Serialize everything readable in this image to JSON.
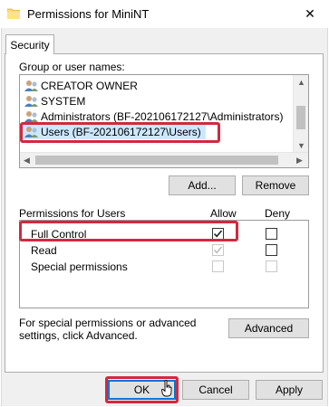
{
  "window": {
    "title": "Permissions for MiniNT",
    "close_glyph": "✕"
  },
  "tabs": [
    {
      "label": "Security",
      "active": true
    }
  ],
  "groups": {
    "label": "Group or user names:",
    "items": [
      {
        "name": "CREATOR OWNER",
        "icon": "users-icon",
        "selected": false
      },
      {
        "name": "SYSTEM",
        "icon": "users-icon",
        "selected": false
      },
      {
        "name": "Administrators (BF-202106172127\\Administrators)",
        "icon": "users-icon",
        "selected": false
      },
      {
        "name": "Users (BF-202106172127\\Users)",
        "icon": "users-icon",
        "selected": true
      }
    ],
    "add_button": "Add...",
    "remove_button": "Remove"
  },
  "permissions": {
    "label": "Permissions for Users",
    "allow_header": "Allow",
    "deny_header": "Deny",
    "rows": [
      {
        "name": "Full Control",
        "allow": true,
        "deny": false,
        "allow_disabled": false,
        "deny_disabled": false
      },
      {
        "name": "Read",
        "allow": true,
        "deny": false,
        "allow_disabled": true,
        "deny_disabled": false
      },
      {
        "name": "Special permissions",
        "allow": false,
        "deny": false,
        "allow_disabled": true,
        "deny_disabled": true
      }
    ]
  },
  "advanced": {
    "help_text": "For special permissions or advanced settings, click Advanced.",
    "button": "Advanced"
  },
  "footer": {
    "ok": "OK",
    "cancel": "Cancel",
    "apply": "Apply"
  },
  "colors": {
    "highlight": "#d1293f",
    "selection": "#cce8ff",
    "accent": "#0078d7"
  }
}
